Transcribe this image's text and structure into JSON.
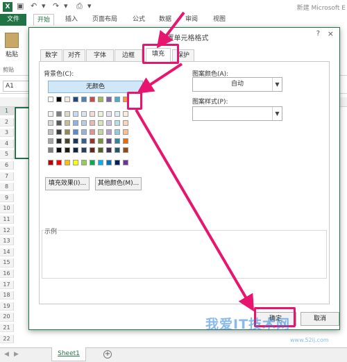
{
  "app": {
    "icon_letter": "X",
    "window_title": "新建 Microsoft E"
  },
  "ribbon": {
    "tabs": [
      "文件",
      "开始",
      "插入",
      "页面布局",
      "公式",
      "数据",
      "审阅",
      "视图"
    ],
    "paste_label": "粘贴",
    "clipboard_label": "剪贴"
  },
  "formula_bar": {
    "name_box": "A1"
  },
  "grid": {
    "rows": [
      "1",
      "2",
      "3",
      "4",
      "5",
      "6",
      "7",
      "8",
      "9",
      "10",
      "11",
      "12",
      "13",
      "14",
      "15",
      "16",
      "17",
      "18",
      "19",
      "20",
      "21",
      "22"
    ]
  },
  "sheet_bar": {
    "sheet_tab": "Sheet1",
    "add_icon": "plus-circle-icon"
  },
  "dialog": {
    "title": "设置单元格格式",
    "help": "?",
    "close": "×",
    "tabs": [
      "数字",
      "对齐",
      "字体",
      "边框",
      "填充",
      "保护"
    ],
    "active_tab": "填充",
    "background_color_label": "背景色(C):",
    "no_color_button": "无颜色",
    "fill_effects_button": "填充效果(I)...",
    "more_colors_button": "其他颜色(M)...",
    "pattern_color_label": "图案颜色(A):",
    "pattern_color_value": "自动",
    "pattern_style_label": "图案样式(P):",
    "pattern_style_value": "",
    "sample_label": "示例",
    "ok_button": "确定",
    "cancel_button": "取消",
    "selected_swatch_color": "#f79646"
  },
  "palette": {
    "theme_top": [
      "#ffffff",
      "#000000",
      "#eeece1",
      "#1f497d",
      "#4f81bd",
      "#c0504d",
      "#9bbb59",
      "#8064a2",
      "#4bacc6",
      "#f79646"
    ],
    "theme_shades": [
      [
        "#f2f2f2",
        "#7f7f7f",
        "#ddd9c3",
        "#c6d9f0",
        "#dbe5f1",
        "#f2dcdb",
        "#ebf1dd",
        "#e5e0ec",
        "#dbeef3",
        "#fdeada"
      ],
      [
        "#d8d8d8",
        "#595959",
        "#c4bd97",
        "#8db3e2",
        "#b8cce4",
        "#e5b9b7",
        "#d7e3bc",
        "#ccc1d9",
        "#b7dde8",
        "#fbd5b5"
      ],
      [
        "#bfbfbf",
        "#3f3f3f",
        "#938953",
        "#548dd4",
        "#95b3d7",
        "#d99694",
        "#c3d69b",
        "#b2a2c7",
        "#92cddc",
        "#fac08f"
      ],
      [
        "#a5a5a5",
        "#262626",
        "#494429",
        "#17365d",
        "#366092",
        "#953734",
        "#76923c",
        "#5f497a",
        "#31859b",
        "#e36c09"
      ],
      [
        "#7f7f7f",
        "#0c0c0c",
        "#1d1b10",
        "#0f243e",
        "#244061",
        "#632423",
        "#4f6128",
        "#3f3151",
        "#205867",
        "#974806"
      ]
    ],
    "standard": [
      "#c00000",
      "#ff0000",
      "#ffc000",
      "#ffff00",
      "#92d050",
      "#00b050",
      "#00b0f0",
      "#0070c0",
      "#002060",
      "#7030a0"
    ]
  },
  "annotation": {
    "color": "#e8156f"
  },
  "watermark": {
    "text": "我爱IT技术网",
    "url": "www.52ij.com"
  }
}
